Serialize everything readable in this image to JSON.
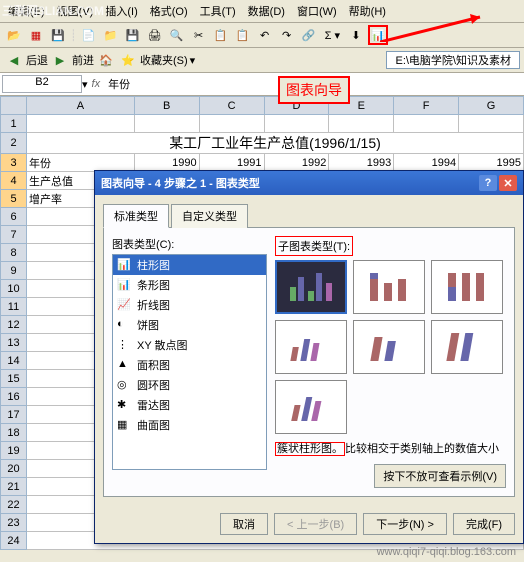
{
  "watermark": "三联网3LIAN.COM",
  "blog": "www.qiqi7-qiqi.blog.163.com",
  "menus": [
    "编辑(E)",
    "视图(V)",
    "插入(I)",
    "格式(O)",
    "工具(T)",
    "数据(D)",
    "窗口(W)",
    "帮助(H)"
  ],
  "addressbar": "E:\\电脑学院\\知识及素材",
  "nav": {
    "back": "后退",
    "fwd": "前进",
    "fav": "收藏夹(S)"
  },
  "callout": "图表向导",
  "name_box": "B2",
  "formula": "年份",
  "grid": {
    "cols": [
      "A",
      "B",
      "C",
      "D",
      "E",
      "F",
      "G"
    ],
    "rows": [
      1,
      2,
      3,
      4,
      5,
      6,
      7,
      8,
      9,
      10,
      11,
      12,
      13,
      14,
      15,
      16,
      17,
      18,
      19,
      20,
      21,
      22,
      23,
      24
    ],
    "title": "某工厂工业年生产总值(1996/1/15)",
    "r3": {
      "label": "年份",
      "vals": [
        "1990",
        "1991",
        "1992",
        "1993",
        "1994",
        "1995"
      ]
    },
    "r4": {
      "label": "生产总值"
    },
    "r5": {
      "label": "增产率"
    }
  },
  "dialog": {
    "title": "图表向导 - 4 步骤之 1 - 图表类型",
    "tabs": [
      "标准类型",
      "自定义类型"
    ],
    "type_label": "图表类型(C):",
    "types": [
      "柱形图",
      "条形图",
      "折线图",
      "饼图",
      "XY 散点图",
      "面积图",
      "圆环图",
      "雷达图",
      "曲面图"
    ],
    "sub_label": "子图表类型(T):",
    "desc_hl": "簇状柱形图。",
    "desc_rest": "比较相交于类别轴上的数值大小",
    "sample_btn": "按下不放可查看示例(V)",
    "btns": {
      "cancel": "取消",
      "back": "< 上一步(B)",
      "next": "下一步(N) >",
      "finish": "完成(F)"
    }
  },
  "chart_data": {
    "type": "bar",
    "title": "某工厂工业年生产总值(1996/1/15)",
    "categories": [
      "1990",
      "1991",
      "1992",
      "1993",
      "1994",
      "1995"
    ],
    "series": [
      {
        "name": "年份",
        "values": [
          1990,
          1991,
          1992,
          1993,
          1994,
          1995
        ]
      },
      {
        "name": "生产总值",
        "values": []
      },
      {
        "name": "增产率",
        "values": []
      }
    ]
  }
}
